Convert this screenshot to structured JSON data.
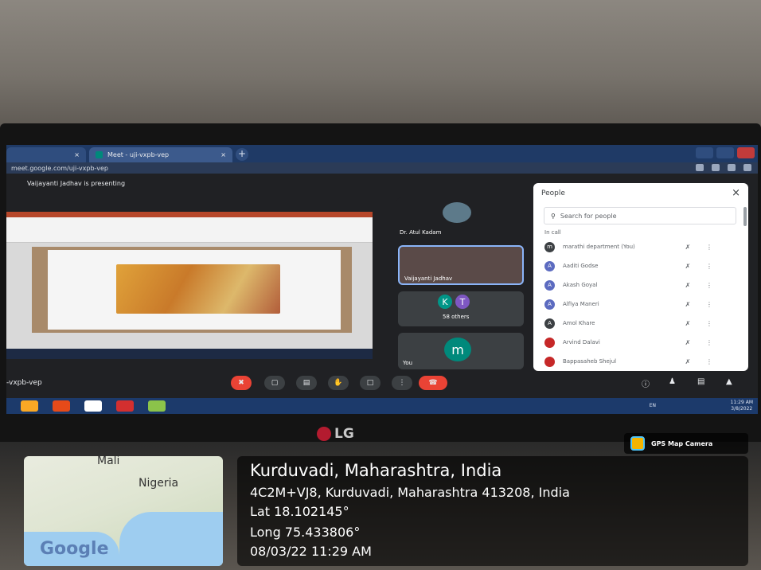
{
  "browser": {
    "tabs": [
      {
        "label": "",
        "close": "×"
      },
      {
        "label": "Meet - uji-vxpb-vep",
        "close": "×"
      }
    ],
    "new_tab": "+",
    "url": "meet.google.com/uji-vxpb-vep"
  },
  "meet": {
    "presenting_text": "Vaijayanti Jadhav is presenting",
    "tiles": [
      {
        "name": "Dr. Atul Kadam"
      },
      {
        "name": "Vaijayanti Jadhav"
      },
      {
        "name": "58 others",
        "avatars": [
          "K",
          "T"
        ]
      },
      {
        "name": "You",
        "avatar": "m"
      }
    ],
    "meeting_code": "-vxpb-vep"
  },
  "people_panel": {
    "title": "People",
    "close_icon": "×",
    "search_placeholder": "Search for people",
    "section_label": "In call",
    "people": [
      {
        "initial": "m",
        "name": "marathi department (You)",
        "color": "#3c4043"
      },
      {
        "initial": "A",
        "name": "Aaditi Godse",
        "color": "#5c6bc0"
      },
      {
        "initial": "A",
        "name": "Akash Goyal",
        "color": "#5c6bc0"
      },
      {
        "initial": "A",
        "name": "Alfiya Maneri",
        "color": "#5c6bc0"
      },
      {
        "initial": "A",
        "name": "Amol Khare",
        "color": "#3c4043"
      },
      {
        "initial": "",
        "name": "Arvind Dalavi",
        "color": "#c62828"
      },
      {
        "initial": "",
        "name": "Bappasaheb Shejul",
        "color": "#c62828"
      }
    ]
  },
  "taskbar": {
    "lang": "EN",
    "time": "11:29 AM",
    "date": "3/8/2022"
  },
  "monitor": {
    "brand": "LG"
  },
  "gps_overlay": {
    "badge": "GPS Map Camera",
    "location": "Kurduvadi, Maharashtra, India",
    "address": "4C2M+VJ8, Kurduvadi, Maharashtra 413208, India",
    "lat": "Lat 18.102145°",
    "long": "Long 75.433806°",
    "datetime": "08/03/22 11:29 AM",
    "map_labels": {
      "mali": "Mali",
      "nigeria": "Nigeria",
      "google": "Google"
    }
  }
}
